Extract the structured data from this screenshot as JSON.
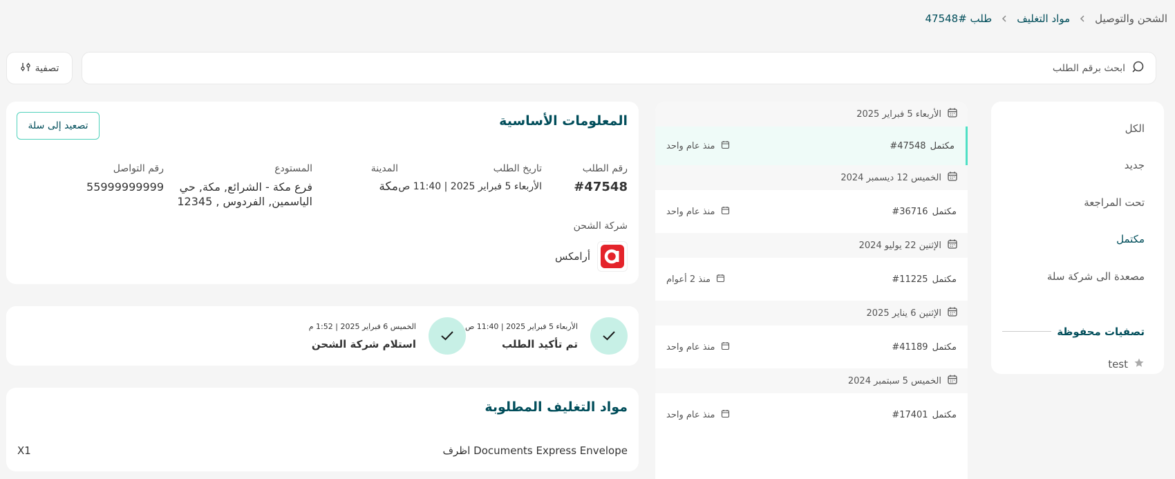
{
  "breadcrumb": {
    "items": [
      "الشحن والتوصيل",
      "مواد التغليف",
      "طلب #47548"
    ]
  },
  "search": {
    "placeholder": "ابحث برقم الطلب",
    "icon": "search-icon"
  },
  "filter": {
    "label": "تصفية",
    "icon": "sliders-icon"
  },
  "sidebar": {
    "items": [
      {
        "label": "الكل",
        "active": false
      },
      {
        "label": "جديد",
        "active": false
      },
      {
        "label": "تحت المراجعة",
        "active": false
      },
      {
        "label": "مكتمل",
        "active": true
      },
      {
        "label": "مصعدة الى شركة سلة",
        "active": false
      }
    ],
    "saved_title": "تصفيات محفوظة",
    "saved_items": [
      {
        "label": "test",
        "icon": "star-icon"
      }
    ]
  },
  "orders": [
    {
      "date": "الأربعاء 5 فبراير 2025",
      "status": "مكتمل",
      "number": "#47548",
      "ago": "منذ عام واحد",
      "selected": true
    },
    {
      "date": "الخميس 12 ديسمبر 2024",
      "status": "مكتمل",
      "number": "#36716",
      "ago": "منذ عام واحد",
      "selected": false
    },
    {
      "date": "الإثنين 22 يوليو 2024",
      "status": "مكتمل",
      "number": "#11225",
      "ago": "منذ 2 أعوام",
      "selected": false
    },
    {
      "date": "الإثنين 6 يناير 2025",
      "status": "مكتمل",
      "number": "#41189",
      "ago": "منذ عام واحد",
      "selected": false
    },
    {
      "date": "الخميس 5 سبتمبر 2024",
      "status": "مكتمل",
      "number": "#17401",
      "ago": "منذ عام واحد",
      "selected": false
    }
  ],
  "basic": {
    "title": "المعلومات الأساسية",
    "escalate_label": "تصعيد إلى سلة",
    "fields": {
      "order_number_label": "رقم الطلب",
      "order_number": "#47548",
      "order_date_label": "تاريخ الطلب",
      "order_date": "الأربعاء 5 فبراير 2025 | 11:40 ص",
      "city_label": "المدينة",
      "city": "مكة",
      "warehouse_label": "المستودع",
      "warehouse": "فرع مكة - الشرائع, مكة, حي الياسمين, الفردوس , 12345",
      "phone_label": "رقم التواصل",
      "phone": "55999999999"
    },
    "shipping_label": "شركة الشحن",
    "shipping_company": "أرامكس",
    "shipping_logo_color": "#e4242b"
  },
  "timeline": [
    {
      "date": "الأربعاء 5 فبراير 2025 | 11:40 ص",
      "title": "تم تأكيد الطلب"
    },
    {
      "date": "الخميس 6 فبراير 2025 | 1:52 م",
      "title": "استلام شركة الشحن"
    }
  ],
  "materials": {
    "title": "مواد التغليف المطلوبة",
    "items": [
      {
        "name": "Documents Express Envelope اظرف",
        "qty": "X1"
      }
    ]
  },
  "colors": {
    "brand": "#004d5a",
    "accent": "#4fe0c5",
    "step_bg": "#c7f0e6"
  }
}
